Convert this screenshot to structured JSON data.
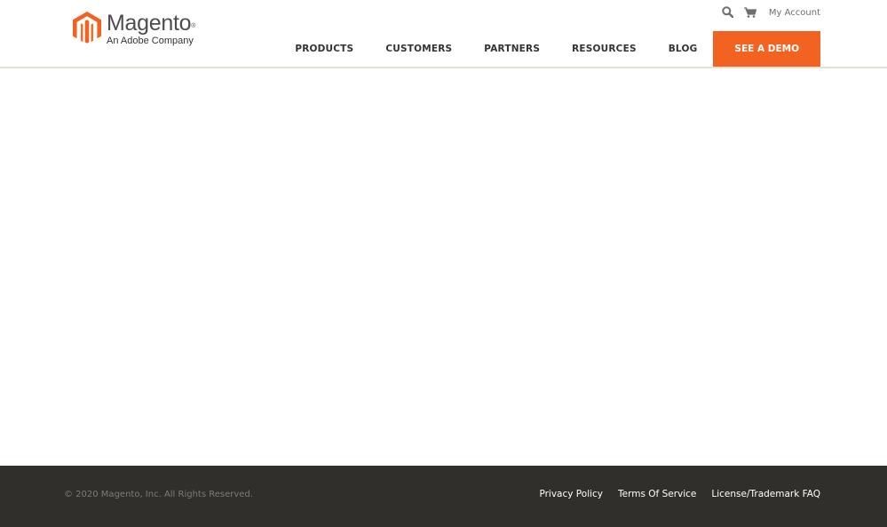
{
  "header": {
    "logo": {
      "name": "Magento",
      "tagline": "An Adobe Company"
    },
    "utility": {
      "search_icon": "search-icon",
      "cart_icon": "cart-icon",
      "account_label": "My Account"
    },
    "nav": [
      {
        "label": "PRODUCTS"
      },
      {
        "label": "CUSTOMERS"
      },
      {
        "label": "PARTNERS"
      },
      {
        "label": "RESOURCES"
      },
      {
        "label": "BLOG"
      }
    ],
    "cta_label": "SEE A DEMO"
  },
  "footer": {
    "copyright": "© 2020 Magento, Inc. All Rights Reserved.",
    "links": [
      {
        "label": "Privacy Policy"
      },
      {
        "label": "Terms Of Service"
      },
      {
        "label": "License/Trademark FAQ"
      }
    ]
  },
  "colors": {
    "brand": "#f26322",
    "footer_bg": "#312f2b"
  }
}
